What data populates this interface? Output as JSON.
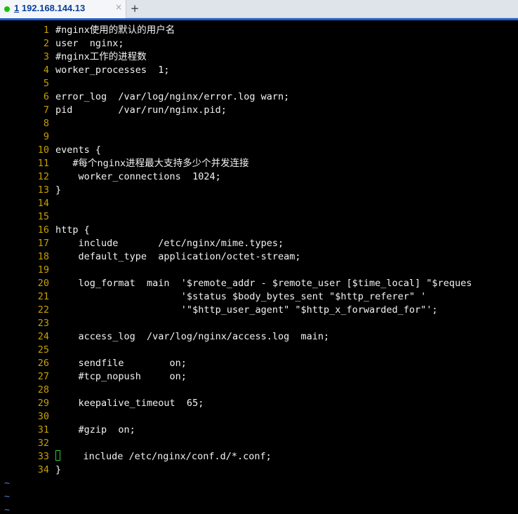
{
  "tab": {
    "number": "1",
    "title": "192.168.144.13",
    "close_glyph": "×",
    "add_glyph": "+"
  },
  "editor": {
    "lines": [
      {
        "n": "1",
        "text": "#nginx使用的默认的用户名"
      },
      {
        "n": "2",
        "text": "user  nginx;"
      },
      {
        "n": "3",
        "text": "#nginx工作的进程数"
      },
      {
        "n": "4",
        "text": "worker_processes  1;"
      },
      {
        "n": "5",
        "text": ""
      },
      {
        "n": "6",
        "text": "error_log  /var/log/nginx/error.log warn;"
      },
      {
        "n": "7",
        "text": "pid        /var/run/nginx.pid;"
      },
      {
        "n": "8",
        "text": ""
      },
      {
        "n": "9",
        "text": ""
      },
      {
        "n": "10",
        "text": "events {"
      },
      {
        "n": "11",
        "text": "   #每个nginx进程最大支持多少个并发连接"
      },
      {
        "n": "12",
        "text": "    worker_connections  1024;"
      },
      {
        "n": "13",
        "text": "}"
      },
      {
        "n": "14",
        "text": ""
      },
      {
        "n": "15",
        "text": ""
      },
      {
        "n": "16",
        "text": "http {"
      },
      {
        "n": "17",
        "text": "    include       /etc/nginx/mime.types;"
      },
      {
        "n": "18",
        "text": "    default_type  application/octet-stream;"
      },
      {
        "n": "19",
        "text": ""
      },
      {
        "n": "20",
        "text": "    log_format  main  '$remote_addr - $remote_user [$time_local] \"$reques"
      },
      {
        "n": "21",
        "text": "                      '$status $body_bytes_sent \"$http_referer\" '"
      },
      {
        "n": "22",
        "text": "                      '\"$http_user_agent\" \"$http_x_forwarded_for\"';"
      },
      {
        "n": "23",
        "text": ""
      },
      {
        "n": "24",
        "text": "    access_log  /var/log/nginx/access.log  main;"
      },
      {
        "n": "25",
        "text": ""
      },
      {
        "n": "26",
        "text": "    sendfile        on;"
      },
      {
        "n": "27",
        "text": "    #tcp_nopush     on;"
      },
      {
        "n": "28",
        "text": ""
      },
      {
        "n": "29",
        "text": "    keepalive_timeout  65;"
      },
      {
        "n": "30",
        "text": ""
      },
      {
        "n": "31",
        "text": "    #gzip  on;"
      },
      {
        "n": "32",
        "text": ""
      },
      {
        "n": "33",
        "text": "    include /etc/nginx/conf.d/*.conf;",
        "cursor": true
      },
      {
        "n": "34",
        "text": "}"
      }
    ],
    "tildes": [
      "~",
      "~",
      "~"
    ]
  },
  "colors": {
    "background": "#000000",
    "text": "#f2f2f2",
    "line_number": "#c8a000",
    "tilde": "#4a7ccf",
    "cursor": "#36c536",
    "tab_title": "#0a3f9a",
    "tab_indicator": "#19c200",
    "accent": "#1f5fd0"
  }
}
